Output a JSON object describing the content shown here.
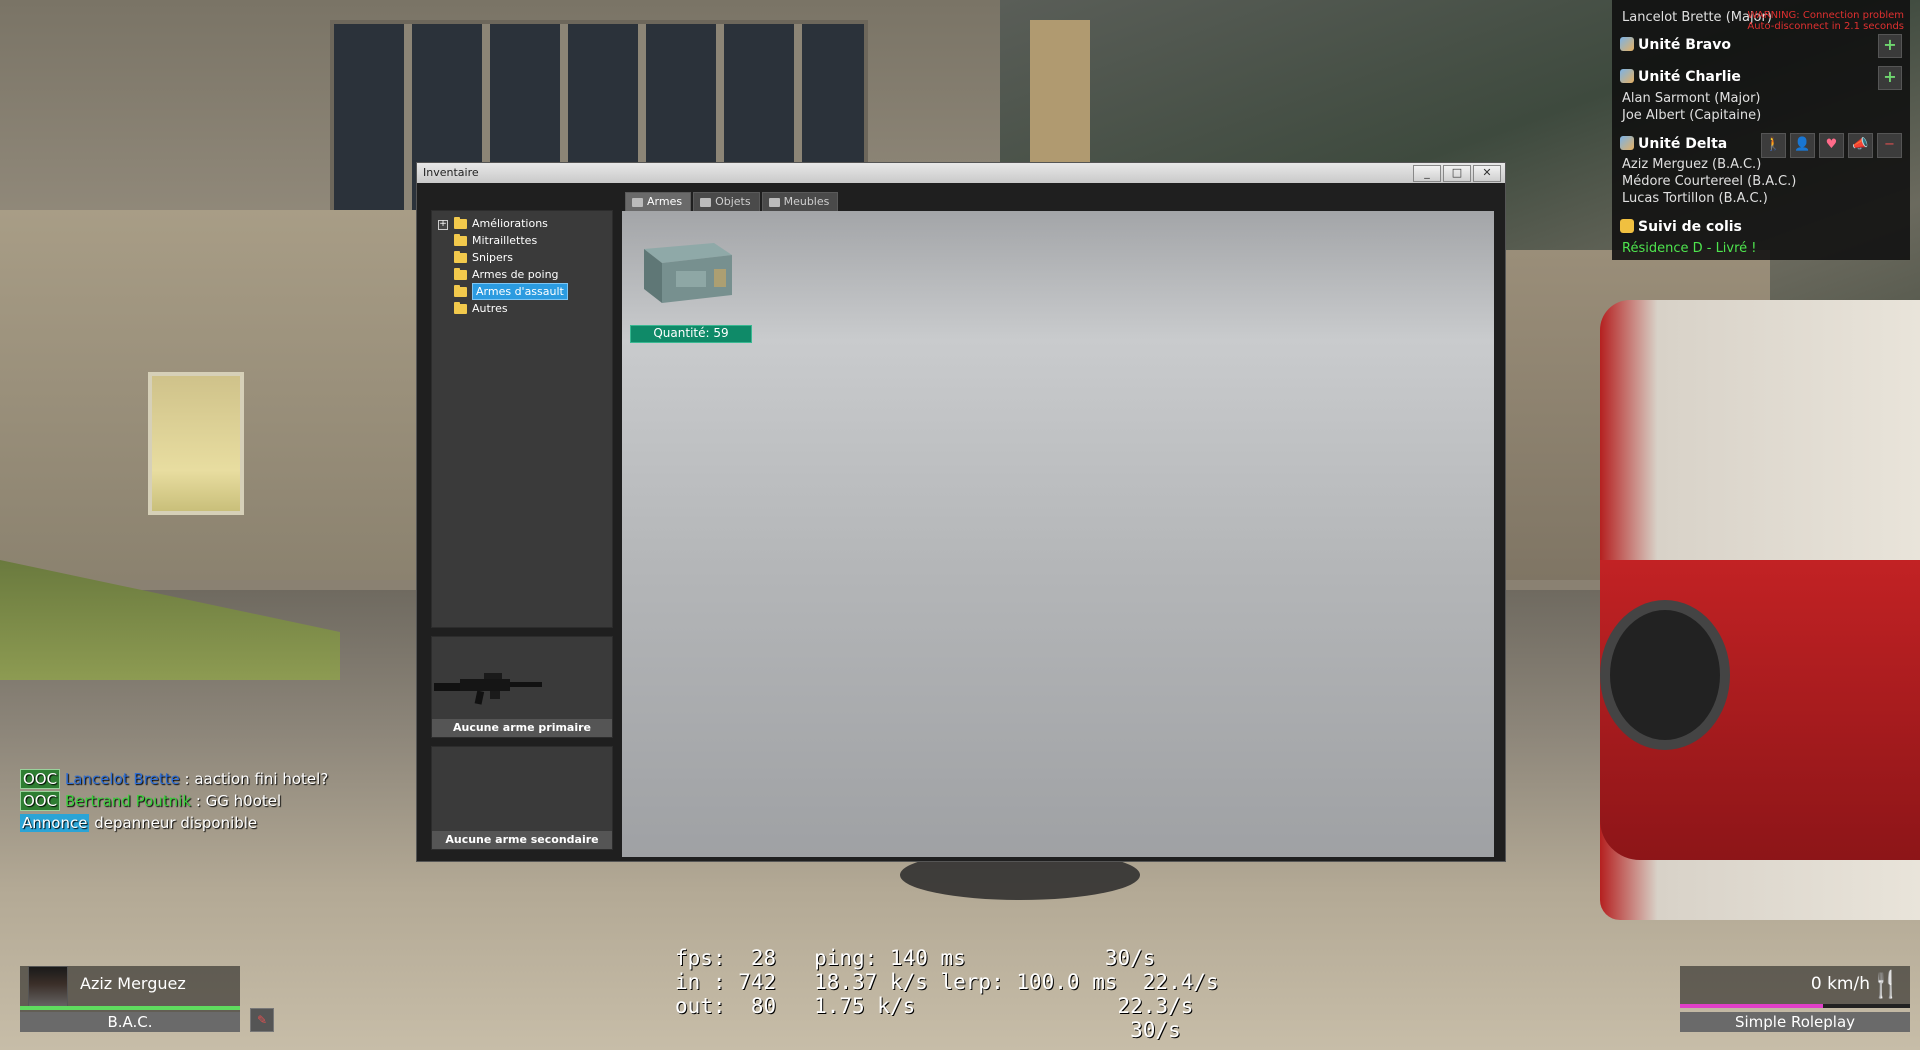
{
  "units": {
    "alpha_member": "Lancelot Brette (Major)",
    "warning_line1": "WARNING: Connection problem",
    "warning_line2": "Auto-disconnect in 2.1 seconds",
    "bravo": {
      "title": "Unité Bravo"
    },
    "charlie": {
      "title": "Unité Charlie",
      "members": [
        "Alan Sarmont (Major)",
        "Joe Albert (Capitaine)"
      ]
    },
    "delta": {
      "title": "Unité Delta",
      "members": [
        "Aziz Merguez (B.A.C.)",
        "Médore Courtereel (B.A.C.)",
        "Lucas Tortillon (B.A.C.)"
      ]
    },
    "colis": {
      "title": "Suivi de colis",
      "status": "Résidence D - Livré !"
    }
  },
  "inventory": {
    "title": "Inventaire",
    "window_buttons": {
      "minimize": "_",
      "maximize": "□",
      "close": "✕"
    },
    "tabs": [
      {
        "label": "Armes",
        "active": true
      },
      {
        "label": "Objets",
        "active": false
      },
      {
        "label": "Meubles",
        "active": false
      }
    ],
    "tree_expander": "+",
    "categories": [
      {
        "label": "Améliorations",
        "selected": false
      },
      {
        "label": "Mitraillettes",
        "selected": false
      },
      {
        "label": "Snipers",
        "selected": false
      },
      {
        "label": "Armes de poing",
        "selected": false
      },
      {
        "label": "Armes d'assault",
        "selected": true
      },
      {
        "label": "Autres",
        "selected": false
      }
    ],
    "primary_slot": "Aucune arme primaire",
    "secondary_slot": "Aucune arme secondaire",
    "item": {
      "quantity_label": "Quantité: 59"
    }
  },
  "chat": [
    {
      "tag": "OOC",
      "tag_type": "ooc",
      "name": "Lancelot Brette",
      "name_color": "blue",
      "sep": " : ",
      "text": "aaction fini hotel?"
    },
    {
      "tag": "OOC",
      "tag_type": "ooc",
      "name": "Bertrand Poutnik",
      "name_color": "green",
      "sep": " : ",
      "text": "GG h0otel"
    },
    {
      "tag": "Annonce",
      "tag_type": "ann",
      "name": "",
      "name_color": "",
      "sep": " ",
      "text": "depanneur disponible"
    }
  ],
  "netstats": {
    "line1": "fps:  28   ping: 140 ms           30/s",
    "line2": "in : 742   18.37 k/s lerp: 100.0 ms  22.4/s",
    "line3": "out:  80   1.75 k/s                22.3/s",
    "line4": "                                    30/s"
  },
  "player": {
    "name": "Aziz Merguez",
    "job": "B.A.C.",
    "health": 1.0
  },
  "vehicle": {
    "speed": "0 km/h",
    "hunger": 0.62
  },
  "server": {
    "name": "Simple Roleplay"
  },
  "colors": {
    "ooc_bg": "#2e7d32",
    "announce_bg": "#2aa4d6",
    "quantity_bg": "#0f8a68",
    "selection": "#2b9be0",
    "colis_status": "#4ee44e",
    "warning": "#e03030"
  }
}
